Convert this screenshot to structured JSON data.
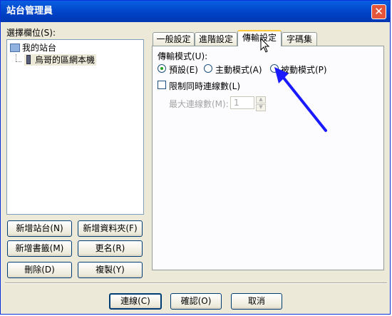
{
  "window": {
    "title": "站台管理員"
  },
  "left": {
    "select_label": "選擇欄位(S):",
    "tree": [
      {
        "label": "我的站台"
      },
      {
        "label": "烏哥的區網本機"
      }
    ],
    "buttons": {
      "new_site": "新增站台(N)",
      "new_folder": "新增資料夾(F)",
      "new_bookmark": "新增書籤(M)",
      "rename": "更名(R)",
      "delete": "刪除(D)",
      "copy": "複製(Y)"
    }
  },
  "tabs": [
    {
      "label": "一般設定"
    },
    {
      "label": "進階設定"
    },
    {
      "label": "傳輸設定"
    },
    {
      "label": "字碼集"
    }
  ],
  "transfer": {
    "mode_label": "傳輸模式(U):",
    "modes": [
      "預設(E)",
      "主動模式(A)",
      "被動模式(P)"
    ],
    "selected_mode": "預設(E)",
    "limit_label": "限制同時連線數(L)",
    "max_label": "最大連線數(M):",
    "max_value": "1"
  },
  "footer": {
    "connect": "連線(C)",
    "ok": "確認(O)",
    "cancel": "取消"
  },
  "colors": {
    "titlebar": "#0054e3",
    "annotation_arrow": "#1a1aff",
    "tab_highlight": "#ffc83c"
  }
}
